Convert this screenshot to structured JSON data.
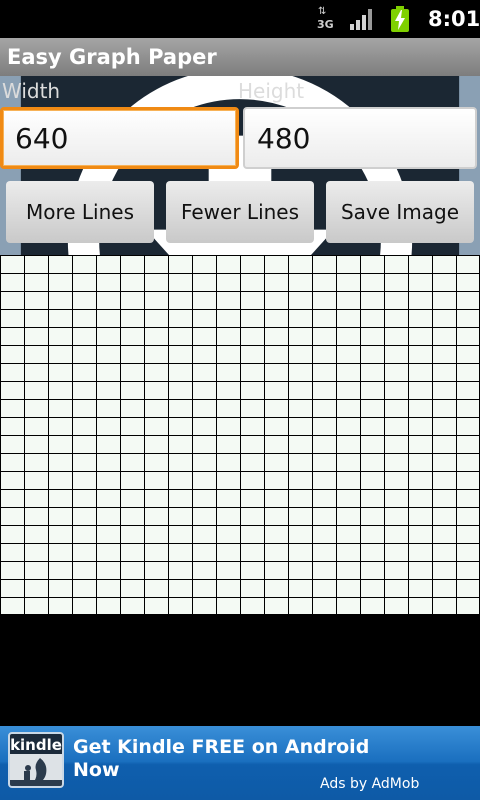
{
  "status_bar": {
    "network": "3G",
    "time": "8:01"
  },
  "app": {
    "title": "Easy Graph Paper"
  },
  "form": {
    "width_label": "Width",
    "height_label": "Height",
    "width_value": "640",
    "height_value": "480"
  },
  "buttons": {
    "more_lines": "More Lines",
    "fewer_lines": "Fewer Lines",
    "save_image": "Save Image"
  },
  "graph": {
    "columns": 20,
    "rows": 20,
    "line_color": "#000000",
    "paper_color": "#f4faf4"
  },
  "ad": {
    "logo_text": "kindle",
    "headline": "Get Kindle FREE on Android Now",
    "attribution": "Ads by AdMob"
  },
  "colors": {
    "focus_accent": "#f08a14",
    "battery": "#7fd000",
    "ad_blue": "#1a6fbf"
  },
  "icons": [
    "network-3g-icon",
    "signal-strength-icon",
    "battery-charging-icon",
    "download-icon"
  ]
}
